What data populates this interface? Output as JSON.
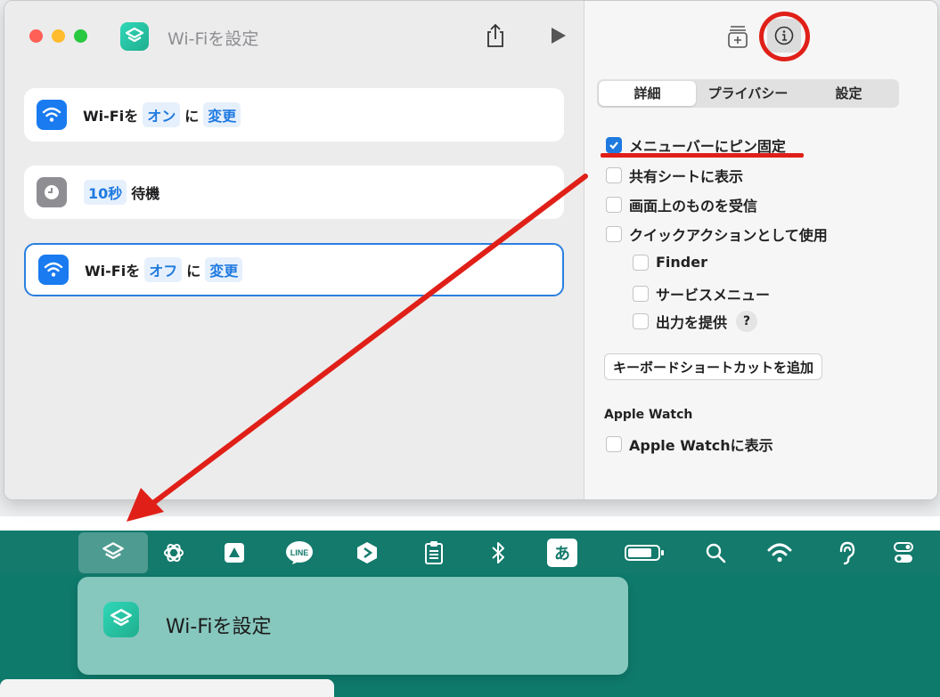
{
  "window": {
    "title": "Wi-Fiを設定",
    "actions": [
      {
        "pre": "Wi-Fiを",
        "token1": "オン",
        "mid": "に",
        "token2": "変更"
      },
      {
        "token1": "10秒",
        "post": "待機"
      },
      {
        "pre": "Wi-Fiを",
        "token1": "オフ",
        "mid": "に",
        "token2": "変更"
      }
    ]
  },
  "inspector": {
    "tabs": [
      "詳細",
      "プライバシー",
      "設定"
    ],
    "options": {
      "pin_menubar": "メニューバーにピン固定",
      "share_sheet": "共有シートに表示",
      "receive_screen": "画面上のものを受信",
      "quick_action": "クイックアクションとして使用",
      "finder": "Finder",
      "services_menu": "サービスメニュー",
      "provide_output": "出力を提供",
      "help": "?"
    },
    "add_shortcut_button": "キーボードショートカットを追加",
    "apple_watch_heading": "Apple Watch",
    "show_on_watch": "Apple Watchに表示",
    "pin_checked": true
  },
  "menubar": {
    "ime_label": "あ",
    "line_label": "LINE"
  },
  "dropdown": {
    "item_label": "Wi-Fiを設定"
  },
  "colors": {
    "accent": "#1f7ae0",
    "annotation_red": "#e02018",
    "menubar_bg": "#137a6c",
    "shortcuts_teal": "#2fd8b9"
  }
}
